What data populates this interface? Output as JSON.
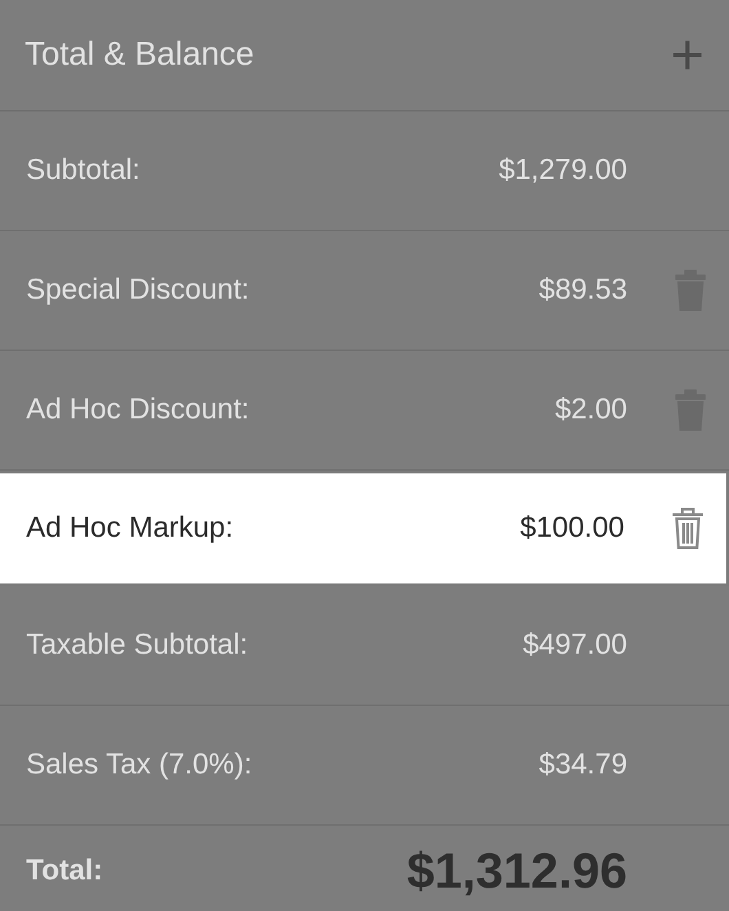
{
  "header": {
    "title": "Total & Balance",
    "add_button": "+"
  },
  "rows": [
    {
      "kind": "line",
      "label": "Subtotal:",
      "amount": "$1,279.00",
      "deletable": false,
      "selected": false
    },
    {
      "kind": "line",
      "label": "Special Discount:",
      "amount": "$89.53",
      "deletable": true,
      "selected": false
    },
    {
      "kind": "line",
      "label": "Ad Hoc Discount:",
      "amount": "$2.00",
      "deletable": true,
      "selected": false
    },
    {
      "kind": "line",
      "label": "Ad Hoc Markup:",
      "amount": "$100.00",
      "deletable": true,
      "selected": true
    },
    {
      "kind": "line",
      "label": "Taxable Subtotal:",
      "amount": "$497.00",
      "deletable": false,
      "selected": false
    },
    {
      "kind": "line",
      "label": "Sales Tax (7.0%):",
      "amount": "$34.79",
      "deletable": false,
      "selected": false
    },
    {
      "kind": "total",
      "label": "Total:",
      "amount": "$1,312.96",
      "deletable": false,
      "selected": false
    }
  ]
}
